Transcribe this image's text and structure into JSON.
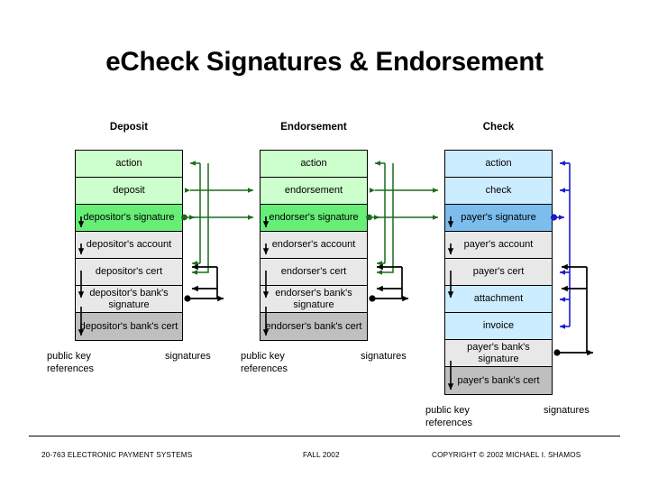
{
  "slide": {
    "title": "eCheck Signatures & Endorsement"
  },
  "columns": [
    {
      "header": "Deposit",
      "rows": [
        {
          "label": "action",
          "fill": "lightgreen"
        },
        {
          "label": "deposit",
          "fill": "lightgreen"
        },
        {
          "label": "depositor's signature",
          "fill": "green"
        },
        {
          "label": "depositor's account",
          "fill": "gray"
        },
        {
          "label": "depositor's cert",
          "fill": "gray"
        },
        {
          "label": "depositor's bank's\nsignature",
          "fill": "gray"
        },
        {
          "label": "depositor's\nbank's cert",
          "fill": "darkgray"
        }
      ],
      "notes": {
        "public_key_references": "public key\nreferences",
        "signatures": "signatures"
      }
    },
    {
      "header": "Endorsement",
      "rows": [
        {
          "label": "action",
          "fill": "lightgreen"
        },
        {
          "label": "endorsement",
          "fill": "lightgreen"
        },
        {
          "label": "endorser's signature",
          "fill": "green"
        },
        {
          "label": "endorser's account",
          "fill": "gray"
        },
        {
          "label": "endorser's cert",
          "fill": "gray"
        },
        {
          "label": "endorser's bank's\nsignature",
          "fill": "gray"
        },
        {
          "label": "endorser's\nbank's cert",
          "fill": "darkgray"
        }
      ],
      "notes": {
        "public_key_references": "public key\nreferences",
        "signatures": "signatures"
      }
    },
    {
      "header": "Check",
      "rows": [
        {
          "label": "action",
          "fill": "lightblue"
        },
        {
          "label": "check",
          "fill": "lightblue"
        },
        {
          "label": "payer's signature",
          "fill": "blue"
        },
        {
          "label": "payer's account",
          "fill": "gray"
        },
        {
          "label": "payer's cert",
          "fill": "gray"
        },
        {
          "label": "attachment",
          "fill": "lightblue"
        },
        {
          "label": "invoice",
          "fill": "lightblue"
        },
        {
          "label": "payer's bank's\nsignature",
          "fill": "gray"
        },
        {
          "label": "payer's\nbank's cert",
          "fill": "darkgray"
        }
      ],
      "notes": {
        "public_key_references": "public key\nreferences",
        "signatures": "signatures"
      }
    }
  ],
  "colors": {
    "light_green": "#ccffcc",
    "green": "#66ee77",
    "light_blue": "#ccecff",
    "blue": "#7cbdee",
    "gray": "#e8e8e8",
    "dark_gray": "#bfbfbf",
    "green_wire": "#1b6b1b",
    "blue_wire": "#1a1ad0",
    "black_wire": "#000000"
  },
  "footer": {
    "left": "20-763 ELECTRONIC PAYMENT SYSTEMS",
    "center": "FALL 2002",
    "right": "COPYRIGHT © 2002 MICHAEL I. SHAMOS"
  }
}
